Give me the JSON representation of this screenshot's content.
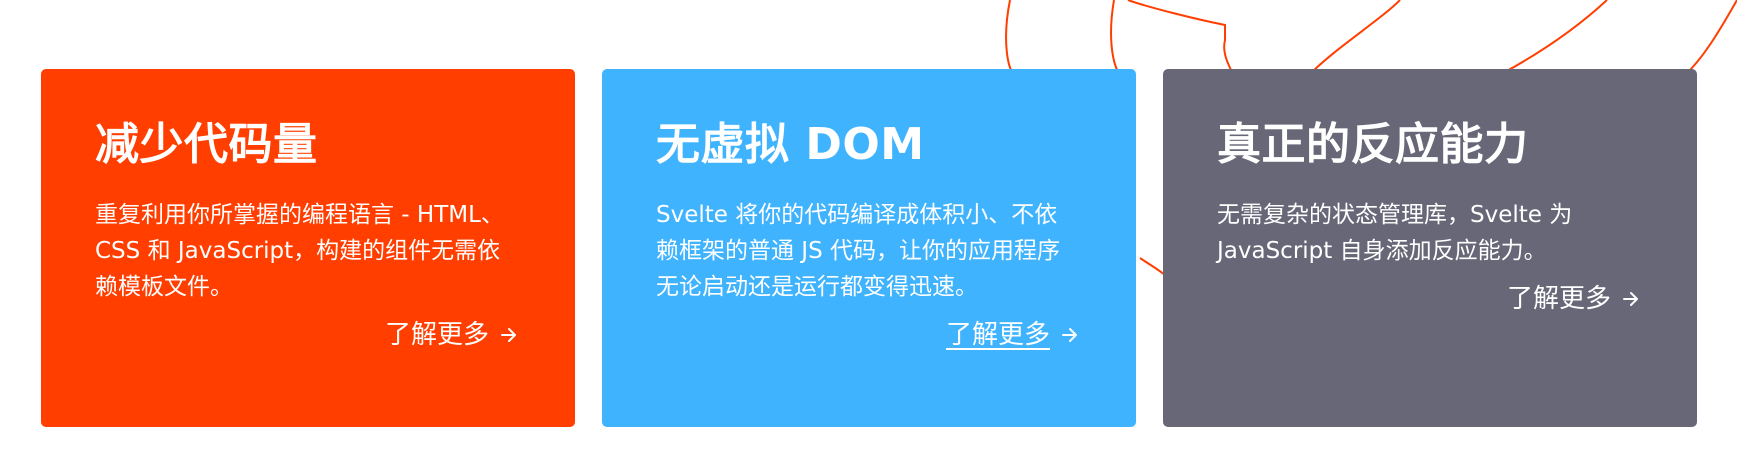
{
  "colors": {
    "card1_bg": "#ff3e00",
    "card2_bg": "#40b3ff",
    "card3_bg": "#676778",
    "logo_stroke": "#ff3e00",
    "text": "#ffffff"
  },
  "cards": [
    {
      "title": "减少代码量",
      "description": "重复利用你所掌握的编程语言 - HTML、CSS 和 JavaScript，构建的组件无需依赖模板文件。",
      "link_label": "了解更多",
      "link_underlined": false,
      "arrow_icon": "arrow-right-icon"
    },
    {
      "title": "无虚拟 DOM",
      "description": "Svelte 将你的代码编译成体积小、不依赖框架的普通 JS 代码，让你的应用程序无论启动还是运行都变得迅速。",
      "link_label": "了解更多",
      "link_underlined": true,
      "arrow_icon": "arrow-right-icon"
    },
    {
      "title": "真正的反应能力",
      "description": "无需复杂的状态管理库，Svelte 为 JavaScript 自身添加反应能力。",
      "link_label": "了解更多",
      "link_underlined": false,
      "arrow_icon": "arrow-right-icon"
    }
  ]
}
